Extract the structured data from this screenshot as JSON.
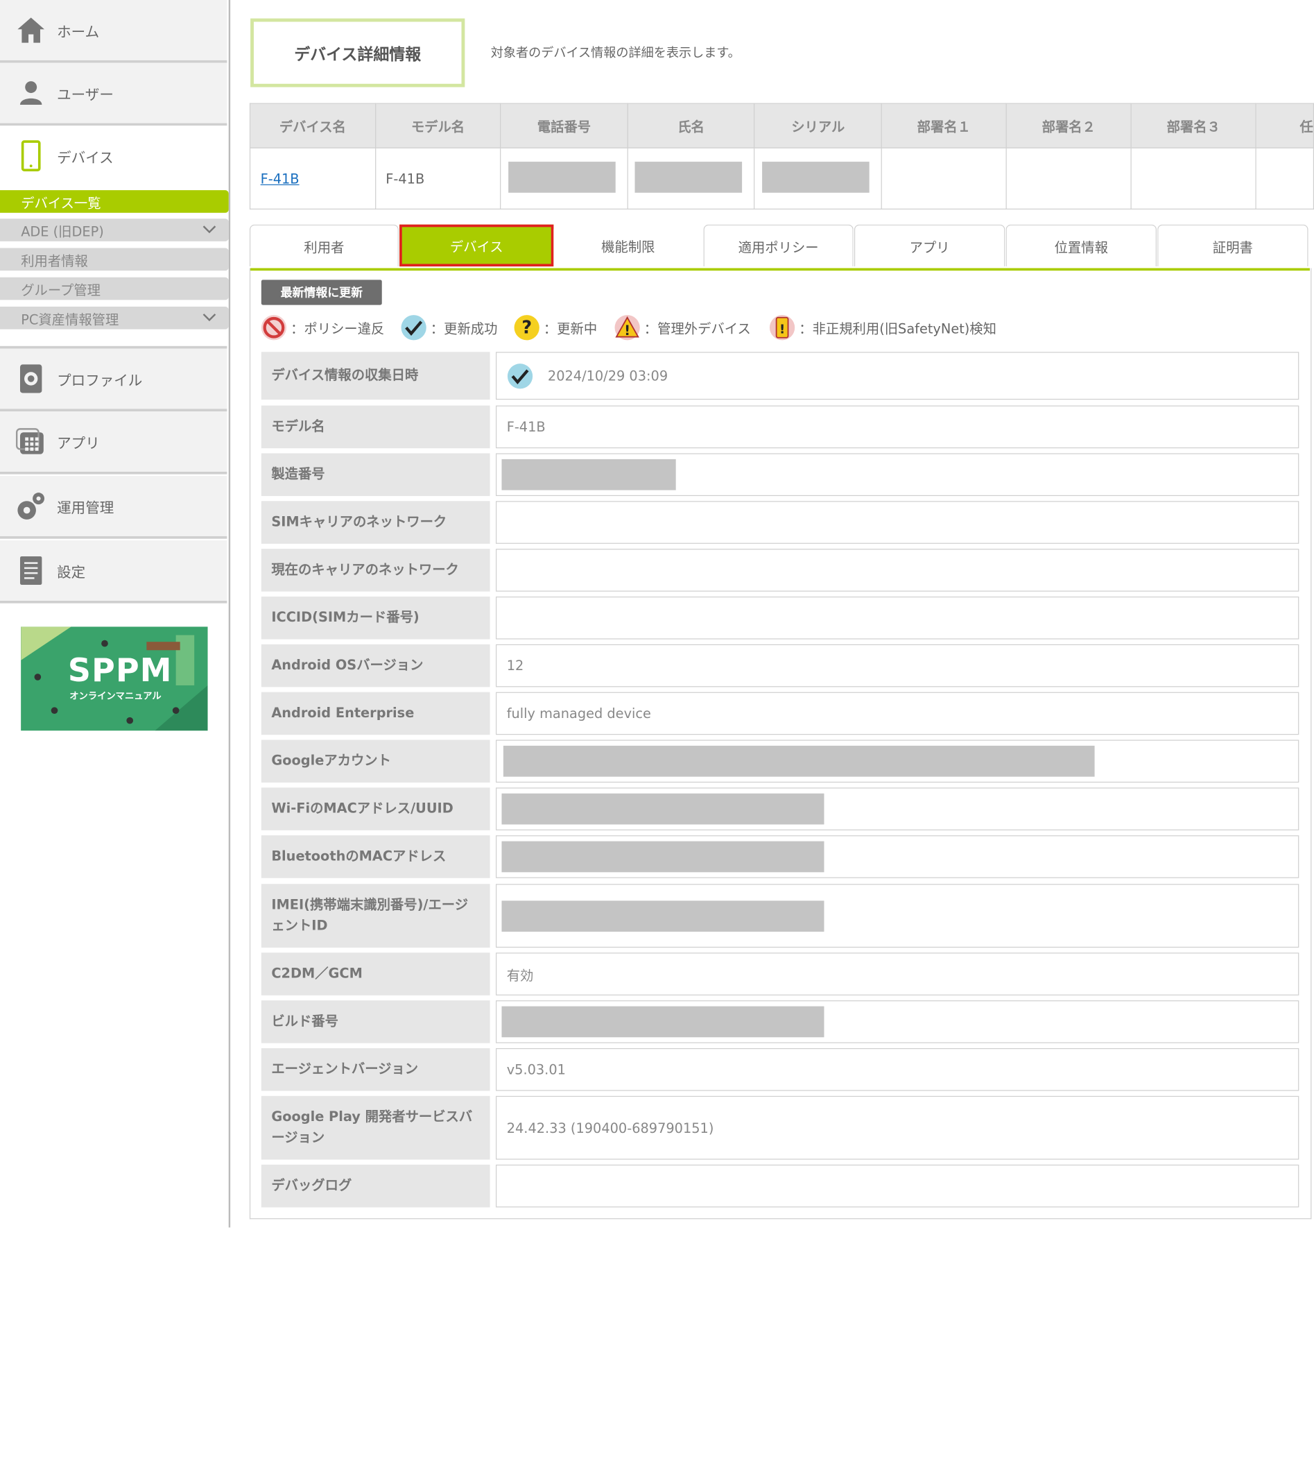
{
  "sidebar": {
    "items": [
      {
        "label": "ホーム",
        "icon": "home-icon"
      },
      {
        "label": "ユーザー",
        "icon": "user-icon"
      },
      {
        "label": "デバイス",
        "icon": "smartphone-icon"
      },
      {
        "label": "プロファイル",
        "icon": "profile-gear-icon"
      },
      {
        "label": "アプリ",
        "icon": "apps-icon"
      },
      {
        "label": "運用管理",
        "icon": "gears-icon"
      },
      {
        "label": "設定",
        "icon": "document-icon"
      }
    ],
    "subitems": [
      {
        "label": "デバイス一覧",
        "active": true
      },
      {
        "label": "ADE (旧DEP)",
        "expandable": true
      },
      {
        "label": "利用者情報"
      },
      {
        "label": "グループ管理"
      },
      {
        "label": "PC資産情報管理",
        "expandable": true
      }
    ],
    "banner": {
      "title": "SPPM",
      "subtitle": "オンラインマニュアル"
    }
  },
  "header": {
    "title": "デバイス詳細情報",
    "description": "対象者のデバイス情報の詳細を表示します。"
  },
  "summary": {
    "columns": [
      "デバイス名",
      "モデル名",
      "電話番号",
      "氏名",
      "シリアル",
      "部署名１",
      "部署名２",
      "部署名３",
      "任"
    ],
    "row": {
      "device_name": "F-41B",
      "model": "F-41B"
    }
  },
  "tabs": [
    "利用者",
    "デバイス",
    "機能制限",
    "適用ポリシー",
    "アプリ",
    "位置情報",
    "証明書"
  ],
  "active_tab": "デバイス",
  "refresh_button": "最新情報に更新",
  "legend": [
    {
      "icon": "policy-violation-icon",
      "label": "：ポリシー違反"
    },
    {
      "icon": "update-success-icon",
      "label": "：更新成功"
    },
    {
      "icon": "updating-icon",
      "label": "：更新中"
    },
    {
      "icon": "unmanaged-device-icon",
      "label": "：管理外デバイス"
    },
    {
      "icon": "unauthorized-use-icon",
      "label": "：非正規利用(旧SafetyNet)検知"
    }
  ],
  "details": [
    {
      "label": "デバイス情報の収集日時",
      "value": "2024/10/29 03:09"
    },
    {
      "label": "モデル名",
      "value": "F-41B"
    },
    {
      "label": "製造番号",
      "value": ""
    },
    {
      "label": "SIMキャリアのネットワーク",
      "value": ""
    },
    {
      "label": "現在のキャリアのネットワーク",
      "value": ""
    },
    {
      "label": "ICCID(SIMカード番号)",
      "value": ""
    },
    {
      "label": "Android OSバージョン",
      "value": "12"
    },
    {
      "label": "Android Enterprise",
      "value": "fully managed device"
    },
    {
      "label": "Googleアカウント",
      "value": ""
    },
    {
      "label": "Wi-FiのMACアドレス/UUID",
      "value": ""
    },
    {
      "label": "BluetoothのMACアドレス",
      "value": ""
    },
    {
      "label": "IMEI(携帯端末識別番号)/エージェントID",
      "value": ""
    },
    {
      "label": "C2DM／GCM",
      "value": "有効"
    },
    {
      "label": "ビルド番号",
      "value": ""
    },
    {
      "label": "エージェントバージョン",
      "value": "v5.03.01"
    },
    {
      "label": "Google Play 開発者サービスバージョン",
      "value": "24.42.33 (190400-689790151)"
    },
    {
      "label": "デバッグログ",
      "value": ""
    }
  ],
  "colors": {
    "accent": "#a9cc00",
    "highlight": "#e02020"
  }
}
